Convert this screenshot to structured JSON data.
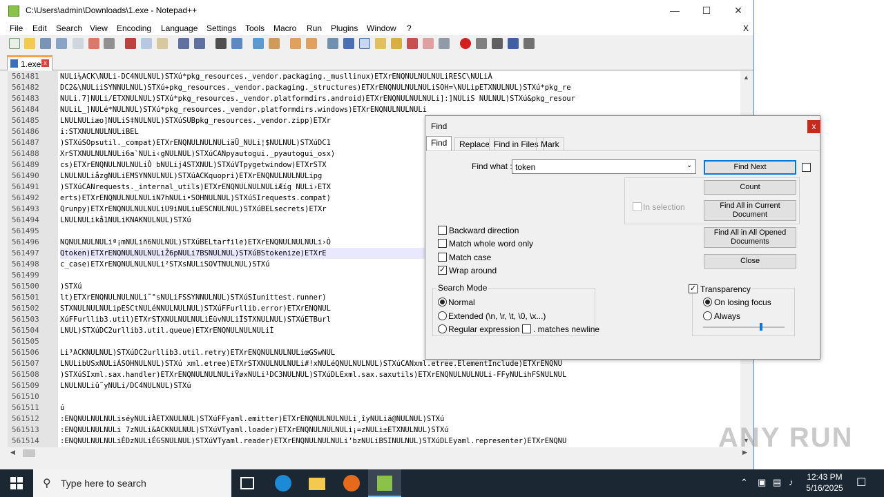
{
  "window": {
    "title": "C:\\Users\\admin\\Downloads\\1.exe - Notepad++"
  },
  "menu": {
    "file": "File",
    "edit": "Edit",
    "search": "Search",
    "view": "View",
    "encoding": "Encoding",
    "language": "Language",
    "settings": "Settings",
    "tools": "Tools",
    "macro": "Macro",
    "run": "Run",
    "plugins": "Plugins",
    "window": "Window",
    "help": "?",
    "close": "X"
  },
  "tab": {
    "label": "1.exe"
  },
  "editor": {
    "ln": [
      "561481",
      "561482",
      "561483",
      "561484",
      "561485",
      "561486",
      "561487",
      "561488",
      "561489",
      "561490",
      "561491",
      "561492",
      "561493",
      "561494",
      "561495",
      "561496",
      "561497",
      "561498",
      "561499",
      "561500",
      "561501",
      "561502",
      "561503",
      "561504",
      "561505",
      "561506",
      "561507",
      "561508",
      "561509",
      "561510",
      "561511",
      "561512",
      "561513",
      "561514"
    ],
    "lines": [
      "NULi¼ACK\\NULi-DC4NULNUL)STXú*pkg_resources._vendor.packaging._musllinux)ETXrENQNULNULNULiRESC\\NULiÀ",
      "DC2&\\NULiiSYNNULNUL)STXú+pkg_resources._vendor.packaging._structures)ETXrENQNULNULNULiSOH=\\NULipETXNULNUL)STXú*pkg_re",
      "NULi.7]NULi/ETXNULNUL)STXú*pkg_resources._vendor.platformdirs.android)ETXrENQNULNULNULi]:]NULiS NULNUL)STXú&pkg_resour",
      "NULiL_]NULé*NULNUL)STXú*pkg_resources._vendor.platformdirs.windows)ETXrENQNULNULNULi",
      "LNULNULiæo]NULiS‡NULNUL)STXúSUBpkg_resources._vendor.zipp)ETXr",
      "i:STXNULNULNULiBEL",
      ")STXúSOpsutil._compat)ETXrENQNULNULNULiäÜ_NULi¦$NULNUL)STXúDC1",
      "XrSTXNULNULNULi6a`NULi‹gNULNUL)STXúCANpyautogui._pyautogui_osx)",
      "cs)ETXrENQNULNULNULiÒ bNULij4STXNUL)STXúVTpygetwindow)ETXrSTX",
      "LNULNULiåzgNULiEMSYNNULNUL)STXúACKquopri)ETXrENQNULNULNULipg",
      ")STXúCANrequests._internal_utils)ETXrENQNULNULNULiÆíg NULi›ETX",
      "erts)ETXrENQNULNULNULiN7hNULi•SOHNULNUL)STXúSIrequests.compat)",
      "Qrunpy)ETXrENQNULNULNULiU9iNULiuESCNULNUL)STXúBELsecrets)ETXr",
      "LNULNULikå1NULiKNAKNULNUL)STXú",
      "",
      "NQNULNULNULiª¡mNULiñ6NULNUL)STXúBELtarfile)ETXrENQNULNULNULi›Ò",
      "Qtoken)ETXrENQNULNULNULiŽ6pNULi7BSNULNUL)STXúBStokenize)ETXrE",
      "c_case)ETXrENQNULNULNULi²STXsNULiSOVTNULNUL)STXú",
      "",
      ")STXú",
      "lt)ETXrENQNULNULNULi˜°sNULiFSSYNNULNUL)STXúSIunittest.runner)",
      "STXNULNULNULipESCtNULéNNULNULNUL)STXúFFurllib.error)ETXrENQNUL",
      "XúFFurllib3.util)ETXrSTXNULNULNULiÉüvNULiÎSTXNULNUL)STXúETBurl",
      "LNUL)STXúDC2urllib3.util.queue)ETXrENQNULNULNULiÌ",
      "",
      "Li³ACKNULNUL)STXúDC2urllib3.util.retry)ETXrENQNULNULNULiœGSwNUL",
      "LNULibUSxNULiÁSOHNULNUL)STXú xml.etree)ETXrSTXNULNULNULi#!xNULéQNULNULNUL)STXúCANxml.etree.ElementInclude)ETXrENQNU",
      ")STXúSIxml.sax.handler)ETXrENQNULNULNULiŸøxNULi¹DC3NULNUL)STXúDLExml.sax.saxutils)ETXrENQNULNULNULi-FFyNULihFSNULNUL",
      "LNULNULiû˜yNULi/DC4NULNUL)STXú",
      "",
      "ú",
      ":ENQNULNULNULiséyNULiÀETXNULNUL)STXúFFyaml.emitter)ETXrENQNULNULNULi¸îyNULiä@NULNUL)STXú",
      ":ENQNULNULNULi 7zNULi&ACKNULNUL)STXúVTyaml.loader)ETXrENQNULNULNULi¡=zNULi±ETXNULNUL)STXú",
      ":ENQNULNULNULiÈDzNULiÉGSNULNUL)STXúVTyaml.reader)ETXrENQNULNULNULi’bzNULiBSINULNUL)STXúDLEyaml.representer)ETXrENQNU"
    ]
  },
  "find": {
    "title": "Find",
    "tab_find": "Find",
    "tab_replace": "Replace",
    "tab_fif": "Find in Files",
    "tab_mark": "Mark",
    "find_what": "Find what :",
    "value": "token",
    "find_next": "Find Next",
    "count": "Count",
    "find_all_current": "Find All in Current Document",
    "find_all_opened": "Find All in All Opened Documents",
    "close": "Close",
    "in_selection": "In selection",
    "backward": "Backward direction",
    "whole_word": "Match whole word only",
    "match_case": "Match case",
    "wrap": "Wrap around",
    "mode_title": "Search Mode",
    "normal": "Normal",
    "extended": "Extended (\\n, \\r, \\t, \\0, \\x...)",
    "regex": "Regular expression",
    "matches_newline": ". matches newline",
    "transparency": "Transparency",
    "on_losing_focus": "On losing focus",
    "always": "Always"
  },
  "taskbar": {
    "search": "Type here to search",
    "time": "12:43 PM",
    "date": "5/16/2025"
  },
  "watermark": "ANY RUN"
}
